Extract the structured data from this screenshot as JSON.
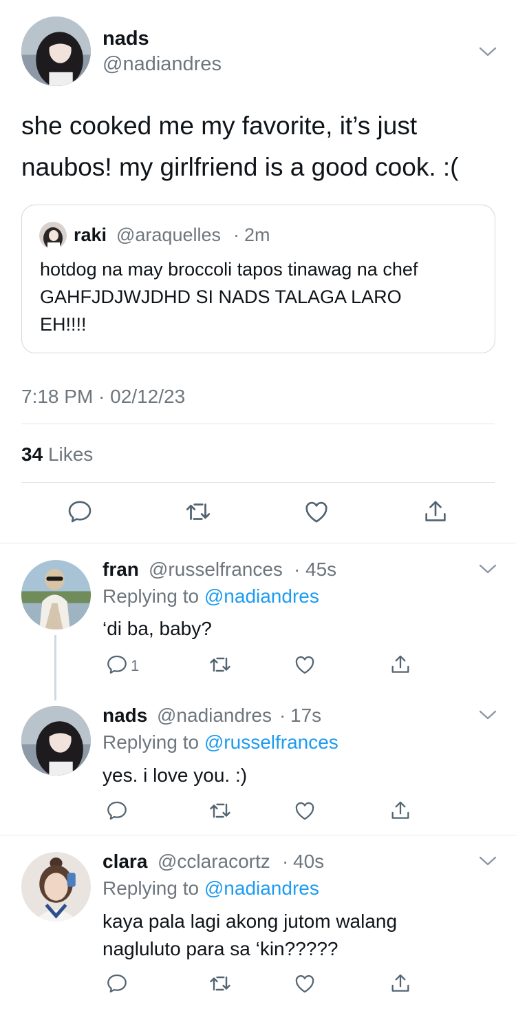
{
  "main_tweet": {
    "display_name": "nads",
    "handle": "@nadiandres",
    "text_line1": "she cooked me my favorite, it’s just",
    "text_line2": "naubos! my girlfriend is a good cook. :(",
    "quote": {
      "display_name": "raki",
      "handle": "@araquelles",
      "separator": "·",
      "time": "2m",
      "text_line1": "hotdog na may broccoli tapos tinawag na chef",
      "text_line2": "GAHFJDJWJDHD SI NADS TALAGA LARO",
      "text_line3": "EH!!!!"
    },
    "timestamp": "7:18 PM · 02/12/23",
    "likes_count": "34",
    "likes_label": "Likes"
  },
  "replies": [
    {
      "display_name": "fran",
      "handle": "@russelfrances",
      "separator": "·",
      "time": "45s",
      "replying_prefix": "Replying to",
      "replying_handle": "@nadiandres",
      "text_line1": "‘di ba, baby?",
      "reply_count": "1"
    },
    {
      "display_name": "nads",
      "handle": "@nadiandres",
      "separator": "·",
      "time": "17s",
      "replying_prefix": "Replying to",
      "replying_handle": "@russelfrances",
      "text_line1": "yes. i love you. :)"
    },
    {
      "display_name": "clara",
      "handle": "@cclaracortz",
      "separator": "·",
      "time": "40s",
      "replying_prefix": "Replying to",
      "replying_handle": "@nadiandres",
      "text_line1": "kaya pala lagi akong jutom walang",
      "text_line2": "nagluluto para sa ‘kin?????"
    }
  ],
  "icons": [
    "chevron-down-icon",
    "reply-icon",
    "retweet-icon",
    "like-icon",
    "share-icon"
  ],
  "colors": {
    "link": "#1d9bf0",
    "secondary_text": "#6e767d",
    "divider": "#e7e7e7"
  }
}
